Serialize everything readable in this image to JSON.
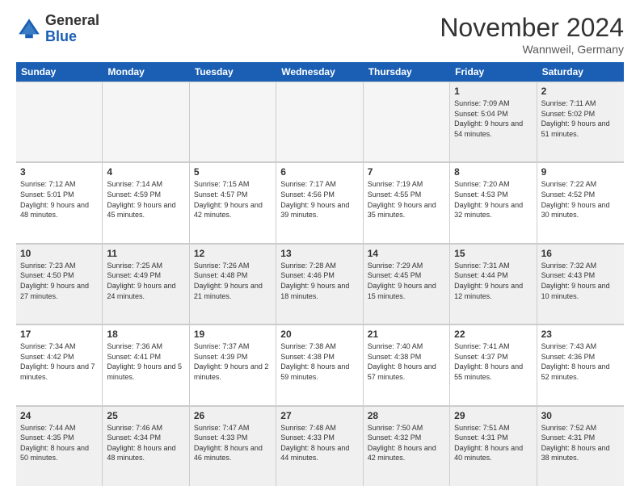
{
  "logo": {
    "general": "General",
    "blue": "Blue"
  },
  "title": "November 2024",
  "location": "Wannweil, Germany",
  "header_days": [
    "Sunday",
    "Monday",
    "Tuesday",
    "Wednesday",
    "Thursday",
    "Friday",
    "Saturday"
  ],
  "rows": [
    [
      {
        "day": "",
        "empty": true
      },
      {
        "day": "",
        "empty": true
      },
      {
        "day": "",
        "empty": true
      },
      {
        "day": "",
        "empty": true
      },
      {
        "day": "",
        "empty": true
      },
      {
        "day": "1",
        "sunrise": "7:09 AM",
        "sunset": "5:04 PM",
        "daylight": "9 hours and 54 minutes."
      },
      {
        "day": "2",
        "sunrise": "7:11 AM",
        "sunset": "5:02 PM",
        "daylight": "9 hours and 51 minutes."
      }
    ],
    [
      {
        "day": "3",
        "sunrise": "7:12 AM",
        "sunset": "5:01 PM",
        "daylight": "9 hours and 48 minutes."
      },
      {
        "day": "4",
        "sunrise": "7:14 AM",
        "sunset": "4:59 PM",
        "daylight": "9 hours and 45 minutes."
      },
      {
        "day": "5",
        "sunrise": "7:15 AM",
        "sunset": "4:57 PM",
        "daylight": "9 hours and 42 minutes."
      },
      {
        "day": "6",
        "sunrise": "7:17 AM",
        "sunset": "4:56 PM",
        "daylight": "9 hours and 39 minutes."
      },
      {
        "day": "7",
        "sunrise": "7:19 AM",
        "sunset": "4:55 PM",
        "daylight": "9 hours and 35 minutes."
      },
      {
        "day": "8",
        "sunrise": "7:20 AM",
        "sunset": "4:53 PM",
        "daylight": "9 hours and 32 minutes."
      },
      {
        "day": "9",
        "sunrise": "7:22 AM",
        "sunset": "4:52 PM",
        "daylight": "9 hours and 30 minutes."
      }
    ],
    [
      {
        "day": "10",
        "sunrise": "7:23 AM",
        "sunset": "4:50 PM",
        "daylight": "9 hours and 27 minutes."
      },
      {
        "day": "11",
        "sunrise": "7:25 AM",
        "sunset": "4:49 PM",
        "daylight": "9 hours and 24 minutes."
      },
      {
        "day": "12",
        "sunrise": "7:26 AM",
        "sunset": "4:48 PM",
        "daylight": "9 hours and 21 minutes."
      },
      {
        "day": "13",
        "sunrise": "7:28 AM",
        "sunset": "4:46 PM",
        "daylight": "9 hours and 18 minutes."
      },
      {
        "day": "14",
        "sunrise": "7:29 AM",
        "sunset": "4:45 PM",
        "daylight": "9 hours and 15 minutes."
      },
      {
        "day": "15",
        "sunrise": "7:31 AM",
        "sunset": "4:44 PM",
        "daylight": "9 hours and 12 minutes."
      },
      {
        "day": "16",
        "sunrise": "7:32 AM",
        "sunset": "4:43 PM",
        "daylight": "9 hours and 10 minutes."
      }
    ],
    [
      {
        "day": "17",
        "sunrise": "7:34 AM",
        "sunset": "4:42 PM",
        "daylight": "9 hours and 7 minutes."
      },
      {
        "day": "18",
        "sunrise": "7:36 AM",
        "sunset": "4:41 PM",
        "daylight": "9 hours and 5 minutes."
      },
      {
        "day": "19",
        "sunrise": "7:37 AM",
        "sunset": "4:39 PM",
        "daylight": "9 hours and 2 minutes."
      },
      {
        "day": "20",
        "sunrise": "7:38 AM",
        "sunset": "4:38 PM",
        "daylight": "8 hours and 59 minutes."
      },
      {
        "day": "21",
        "sunrise": "7:40 AM",
        "sunset": "4:38 PM",
        "daylight": "8 hours and 57 minutes."
      },
      {
        "day": "22",
        "sunrise": "7:41 AM",
        "sunset": "4:37 PM",
        "daylight": "8 hours and 55 minutes."
      },
      {
        "day": "23",
        "sunrise": "7:43 AM",
        "sunset": "4:36 PM",
        "daylight": "8 hours and 52 minutes."
      }
    ],
    [
      {
        "day": "24",
        "sunrise": "7:44 AM",
        "sunset": "4:35 PM",
        "daylight": "8 hours and 50 minutes."
      },
      {
        "day": "25",
        "sunrise": "7:46 AM",
        "sunset": "4:34 PM",
        "daylight": "8 hours and 48 minutes."
      },
      {
        "day": "26",
        "sunrise": "7:47 AM",
        "sunset": "4:33 PM",
        "daylight": "8 hours and 46 minutes."
      },
      {
        "day": "27",
        "sunrise": "7:48 AM",
        "sunset": "4:33 PM",
        "daylight": "8 hours and 44 minutes."
      },
      {
        "day": "28",
        "sunrise": "7:50 AM",
        "sunset": "4:32 PM",
        "daylight": "8 hours and 42 minutes."
      },
      {
        "day": "29",
        "sunrise": "7:51 AM",
        "sunset": "4:31 PM",
        "daylight": "8 hours and 40 minutes."
      },
      {
        "day": "30",
        "sunrise": "7:52 AM",
        "sunset": "4:31 PM",
        "daylight": "8 hours and 38 minutes."
      }
    ]
  ],
  "labels": {
    "sunrise": "Sunrise:",
    "sunset": "Sunset:",
    "daylight": "Daylight:"
  }
}
